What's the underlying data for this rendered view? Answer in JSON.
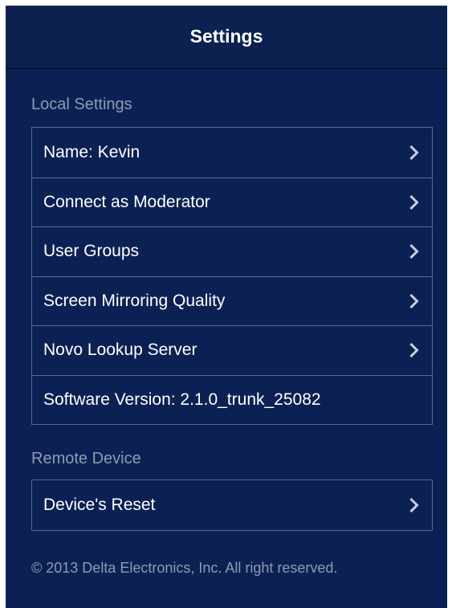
{
  "header": {
    "title": "Settings"
  },
  "sections": [
    {
      "header": "Local Settings",
      "rows": [
        {
          "label": "Name: Kevin",
          "chevron_icon": "chevron-right-icon"
        },
        {
          "label": "Connect as Moderator",
          "chevron_icon": "chevron-right-icon"
        },
        {
          "label": "User Groups",
          "chevron_icon": "chevron-right-icon"
        },
        {
          "label": "Screen Mirroring Quality",
          "chevron_icon": "chevron-right-icon"
        },
        {
          "label": "Novo Lookup Server",
          "chevron_icon": "chevron-right-icon"
        },
        {
          "label": "Software Version: 2.1.0_trunk_25082"
        }
      ]
    },
    {
      "header": "Remote Device",
      "rows": [
        {
          "label": "Device's Reset",
          "chevron_icon": "chevron-right-icon"
        }
      ]
    }
  ],
  "footer": {
    "copyright": "© 2013 Delta Electronics, Inc. All right reserved."
  },
  "colors": {
    "background": "#0c2153",
    "section_header": "#8f9ab4",
    "separator": "#5b6a8c",
    "chevron": "#c9cfdc",
    "text": "#ffffff"
  }
}
